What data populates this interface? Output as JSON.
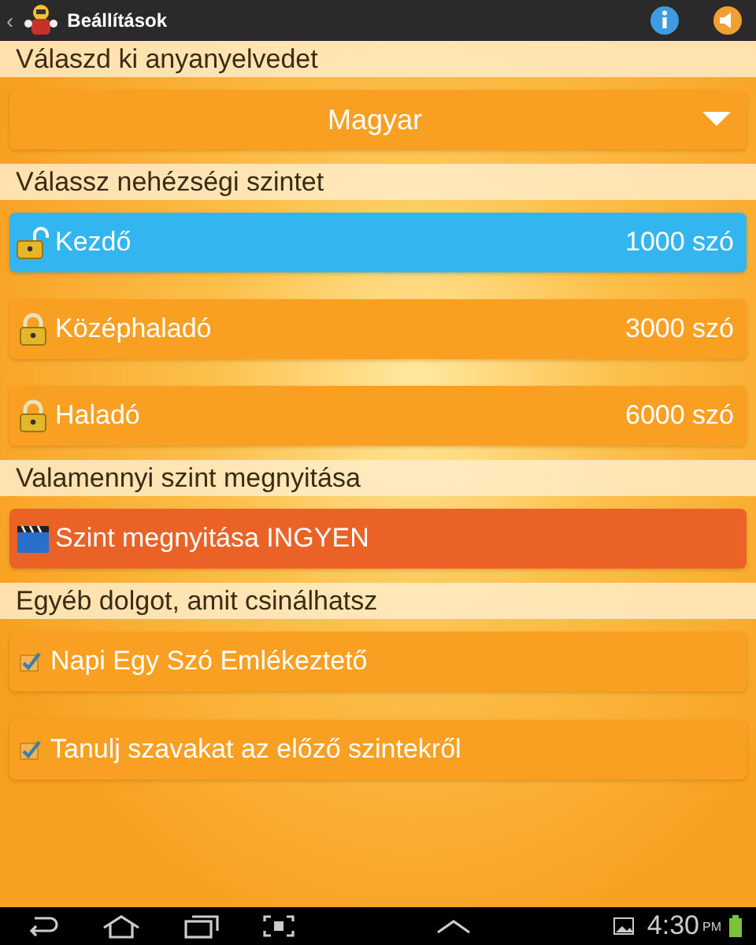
{
  "action_bar": {
    "back": "‹",
    "title": "Beállítások"
  },
  "sections": [
    {
      "header": "Válaszd ki anyanyelvedet",
      "kind": "dropdown",
      "value": "Magyar"
    },
    {
      "header": "Válassz nehézségi szintet",
      "kind": "levels",
      "levels": [
        {
          "name": "Kezdő",
          "words": "1000 szó",
          "selected": true,
          "unlocked": true
        },
        {
          "name": "Középhaladó",
          "words": "3000 szó",
          "selected": false,
          "unlocked": false
        },
        {
          "name": "Haladó",
          "words": "6000 szó",
          "selected": false,
          "unlocked": false
        }
      ]
    },
    {
      "header": "Valamennyi szint megnyitása",
      "kind": "unlock",
      "label": "Szint megnyitása INGYEN"
    },
    {
      "header": "Egyéb dolgot, amit csinálhatsz",
      "kind": "options",
      "options": [
        {
          "label": "Napi Egy Szó Emlékeztető",
          "checked": true
        },
        {
          "label": "Tanulj szavakat az előző szintekről",
          "checked": true
        }
      ]
    }
  ],
  "status_bar": {
    "time": "4:30",
    "ampm": "PM"
  }
}
